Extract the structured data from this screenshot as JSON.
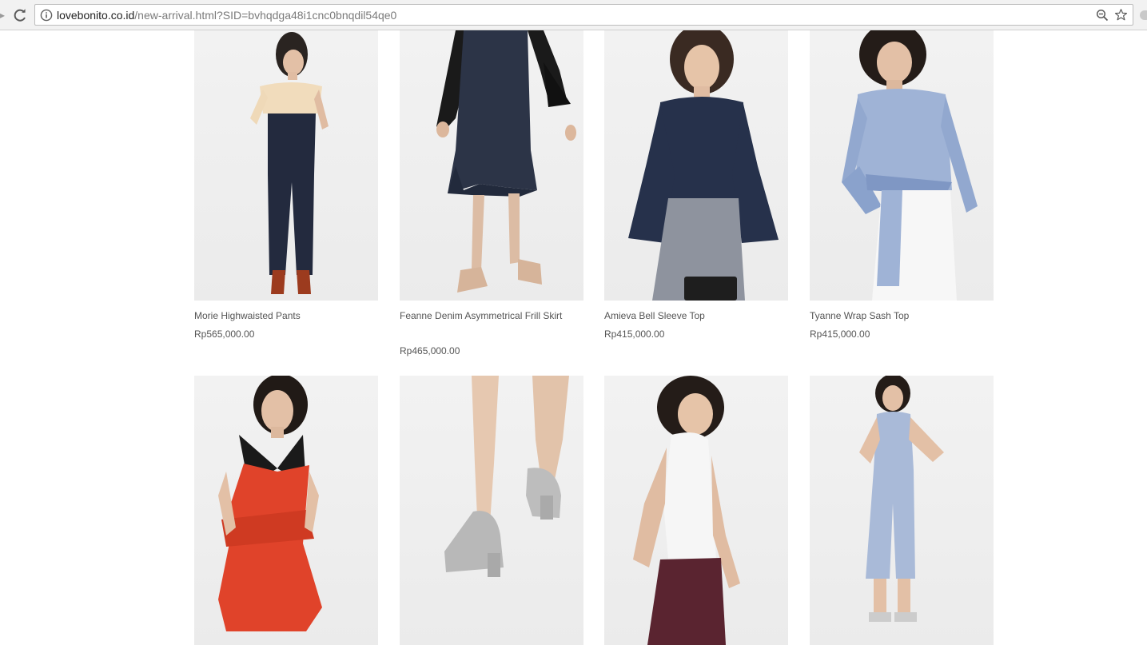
{
  "browser": {
    "url_host": "lovebonito.co.id",
    "url_path": "/new-arrival.html?SID=bvhqdga48i1cnc0bnqdil54qe0",
    "icons": {
      "reload": "reload-icon",
      "info": "info-icon",
      "zoom": "zoom-icon",
      "bookmark": "bookmark-star-icon"
    }
  },
  "products": [
    {
      "name": "Morie Highwaisted Pants",
      "price": "Rp565,000.00"
    },
    {
      "name": "Feanne Denim Asymmetrical Frill Skirt",
      "price": "Rp465,000.00"
    },
    {
      "name": "Amieva Bell Sleeve Top",
      "price": "Rp415,000.00"
    },
    {
      "name": "Tyanne Wrap Sash Top",
      "price": "Rp415,000.00"
    },
    {
      "name": "",
      "price": ""
    },
    {
      "name": "",
      "price": ""
    },
    {
      "name": "",
      "price": ""
    },
    {
      "name": "",
      "price": ""
    }
  ],
  "colors": {
    "text": "#555555",
    "chrome": "#f2f2f2",
    "image_bg": "#eeeeee"
  }
}
